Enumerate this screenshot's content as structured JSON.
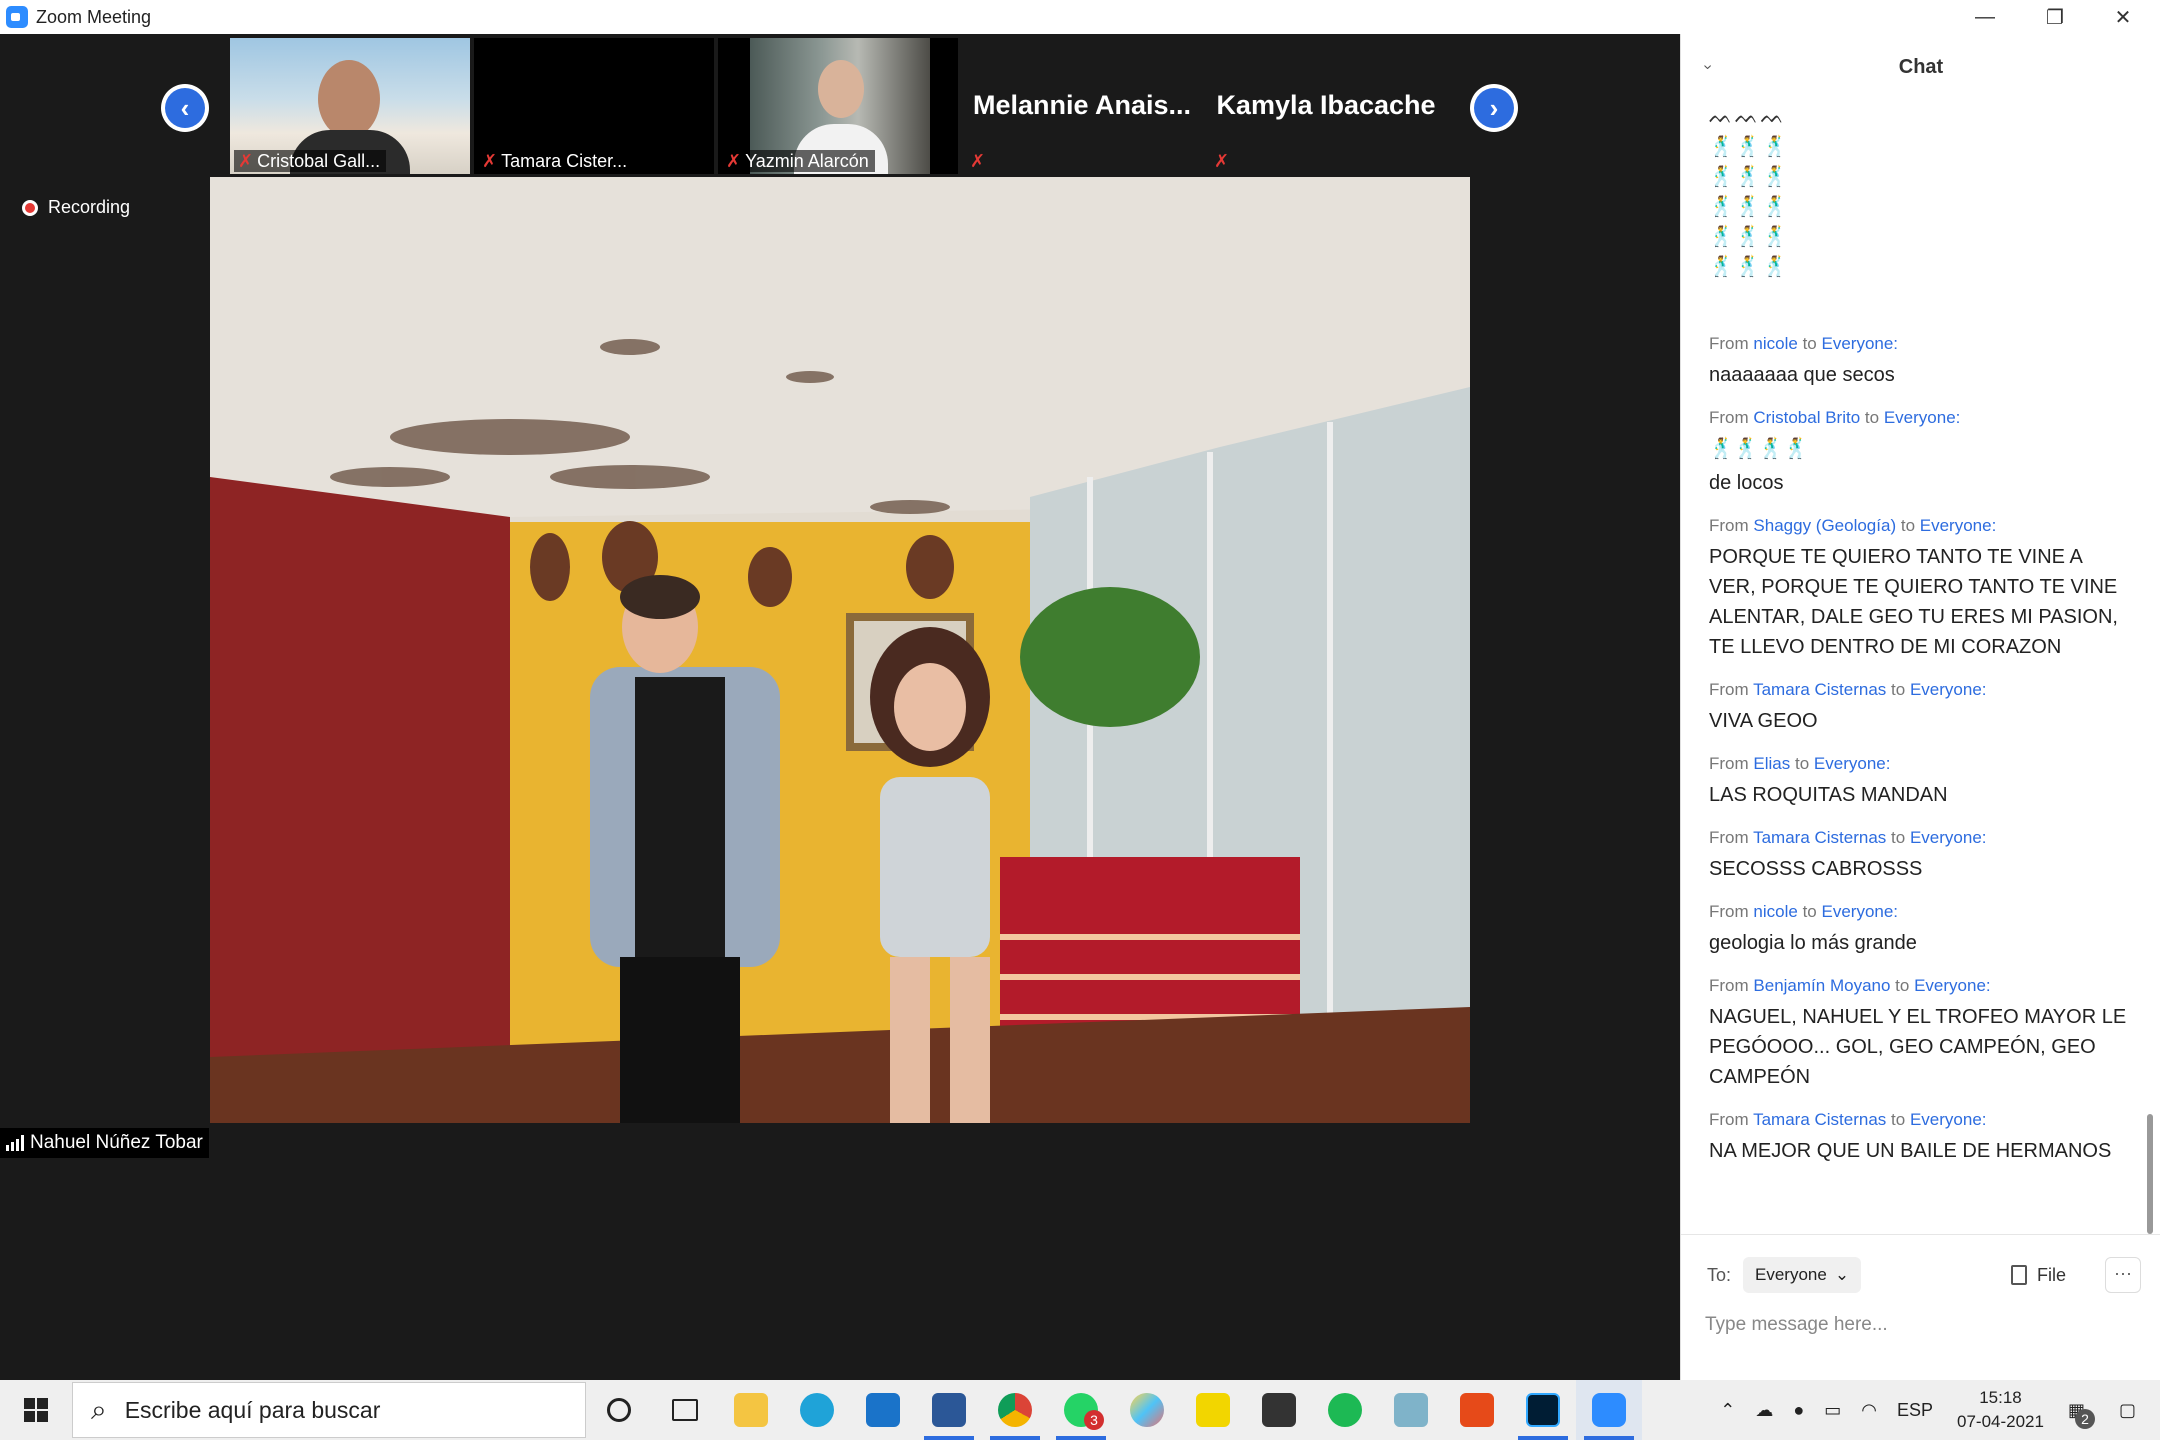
{
  "window": {
    "title": "Zoom Meeting",
    "minimize": "—",
    "maximize": "❐",
    "close": "✕"
  },
  "gallery": {
    "prev": "‹",
    "next": "›",
    "participants": [
      {
        "name": "Cristobal Gall..."
      },
      {
        "name": "Tamara Cister..."
      },
      {
        "name": "Yazmin Alarcón"
      },
      {
        "name": "Melannie  Anais..."
      },
      {
        "name": "Kamyla Ibacache"
      }
    ],
    "mic_icon": "✗"
  },
  "recording": {
    "label": "Recording"
  },
  "speaker": {
    "name": "Nahuel Núñez Tobar"
  },
  "chat": {
    "title": "Chat",
    "collapse": "›",
    "top_emojis": [
      "ᨓᨓᨓ",
      "🕺🕺🕺",
      "🕺🕺🕺",
      "🕺🕺🕺",
      "🕺🕺🕺",
      "🕺🕺🕺"
    ],
    "from_word": "From",
    "to_word": "to",
    "messages": [
      {
        "sender": "nicole",
        "recipient": "Everyone:",
        "text": "naaaaaaa que secos"
      },
      {
        "sender": "Cristobal Brito",
        "recipient": "Everyone:",
        "text": "🕺🕺🕺🕺",
        "text2": "de locos"
      },
      {
        "sender": "Shaggy (Geología)",
        "recipient": "Everyone:",
        "text": "PORQUE TE QUIERO TANTO TE VINE A VER, PORQUE TE QUIERO TANTO TE VINE ALENTAR, DALE GEO TU ERES MI PASION, TE LLEVO DENTRO DE MI CORAZON"
      },
      {
        "sender": "Tamara Cisternas",
        "recipient": "Everyone:",
        "text": "VIVA GEOO"
      },
      {
        "sender": "Elias",
        "recipient": "Everyone:",
        "text": "LAS ROQUITAS MANDAN"
      },
      {
        "sender": "Tamara Cisternas",
        "recipient": "Everyone:",
        "text": "SECOSSS CABROSSS"
      },
      {
        "sender": "nicole",
        "recipient": "Everyone:",
        "text": "geologia lo más grande"
      },
      {
        "sender": "Benjamín Moyano",
        "recipient": "Everyone:",
        "text": "NAGUEL, NAHUEL Y EL TROFEO MAYOR  LE PEGÓOOO... GOL, GEO CAMPEÓN, GEO CAMPEÓN"
      },
      {
        "sender": "Tamara Cisternas",
        "recipient": "Everyone:",
        "text": "NA MEJOR QUE UN BAILE DE HERMANOS"
      }
    ],
    "footer": {
      "to_label": "To:",
      "to_value": "Everyone",
      "chevron": "⌄",
      "file_label": "File",
      "more_label": "···",
      "placeholder": "Type message here..."
    }
  },
  "taskbar": {
    "search_placeholder": "Escribe aquí para buscar",
    "search_icon": "⌕",
    "whatsapp_badge": "3",
    "tray_language": "ESP",
    "time": "15:18",
    "date": "07-04-2021",
    "notification_badge": "2"
  }
}
